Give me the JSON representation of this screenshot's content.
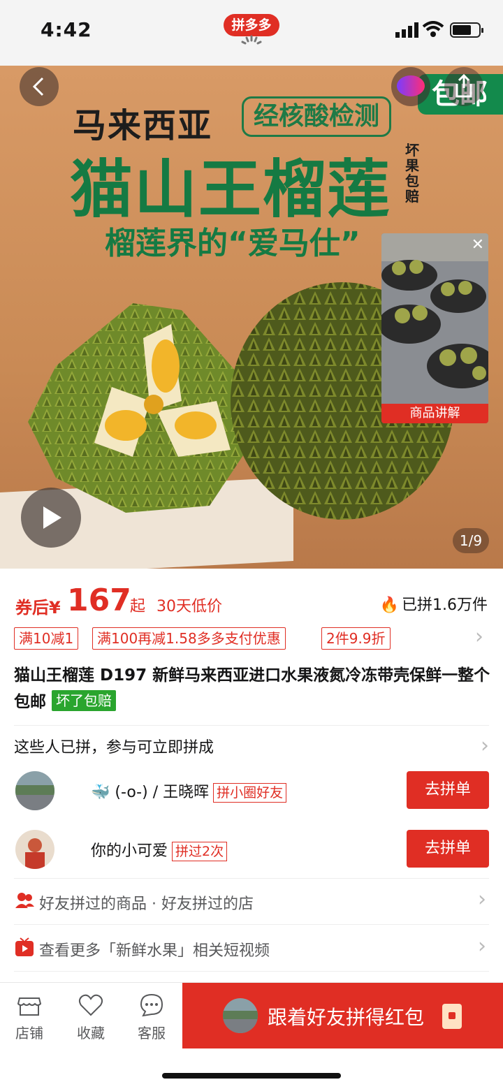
{
  "status_bar": {
    "time": "4:42",
    "app_logo_text": "拼多多"
  },
  "hero": {
    "country": "马来西亚",
    "inspection": "经核酸检测",
    "product_title": "猫山王榴莲",
    "guarantee_vertical": "坏果包赔",
    "slogan": "榴莲界的“爱马仕”",
    "badge_free_shipping": "包邮",
    "mini_video_label": "商品讲解",
    "page_indicator": "1/9"
  },
  "price": {
    "prefix": "券后¥",
    "amount": "167",
    "suffix": "起",
    "low_price_tag": "30天低价",
    "sold_text": "已拼1.6万件"
  },
  "coupons": [
    "满10减1",
    "满100再减1.58多多支付优惠",
    "2件9.9折"
  ],
  "product": {
    "title": "猫山王榴莲 D197 新鲜马来西亚进口水果液氮冷冻带壳保鲜一整个包邮",
    "tag": "坏了包赔"
  },
  "group": {
    "heading": "这些人已拼，参与可立即拼成",
    "members": [
      {
        "name": "🐳 (-o-) / 王晓晖",
        "tag": "拼小圈好友",
        "button": "去拼单"
      },
      {
        "name": "你的小可爱",
        "tag": "拼过2次",
        "button": "去拼单"
      }
    ]
  },
  "links": {
    "friends_text": "好友拼过的商品 · 好友拼过的店",
    "videos_text": "查看更多「新鲜水果」相关短视频"
  },
  "bottom_bar": {
    "tabs": [
      "店铺",
      "收藏",
      "客服"
    ],
    "cta": "跟着好友拼得红包"
  },
  "colors": {
    "brand_red": "#e02e24",
    "green_tag": "#2aa52e",
    "hero_bg": "#d89a66"
  }
}
